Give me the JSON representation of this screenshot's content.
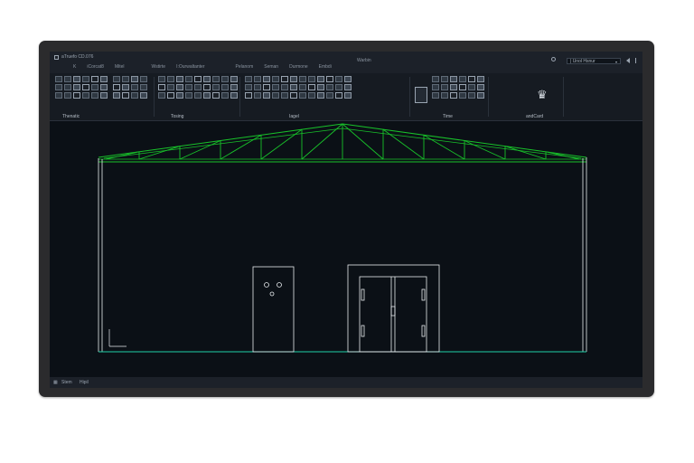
{
  "app": {
    "name": "aTruefo CD.076",
    "window_title": "Warbin"
  },
  "menu": [
    "K",
    "iCorcat8",
    "Mitel",
    "Wstirte",
    "I:Ourwaltanter",
    "Pelanom",
    "Seman",
    "Durmone",
    "Embdi"
  ],
  "workspace": {
    "value": "| Unol Hsnur",
    "arrow": "▾"
  },
  "ribbon": {
    "groups": [
      "Thenatic",
      "Tosing",
      "Iagel",
      "Time",
      "andCard"
    ],
    "crown_icon": "crown-icon"
  },
  "status": {
    "left": "Stem",
    "right": "Hipil"
  },
  "colors": {
    "truss": "#18c22a",
    "ground": "#1fd0a8",
    "lines": "#e8ecef",
    "canvas": "#0b1016"
  }
}
